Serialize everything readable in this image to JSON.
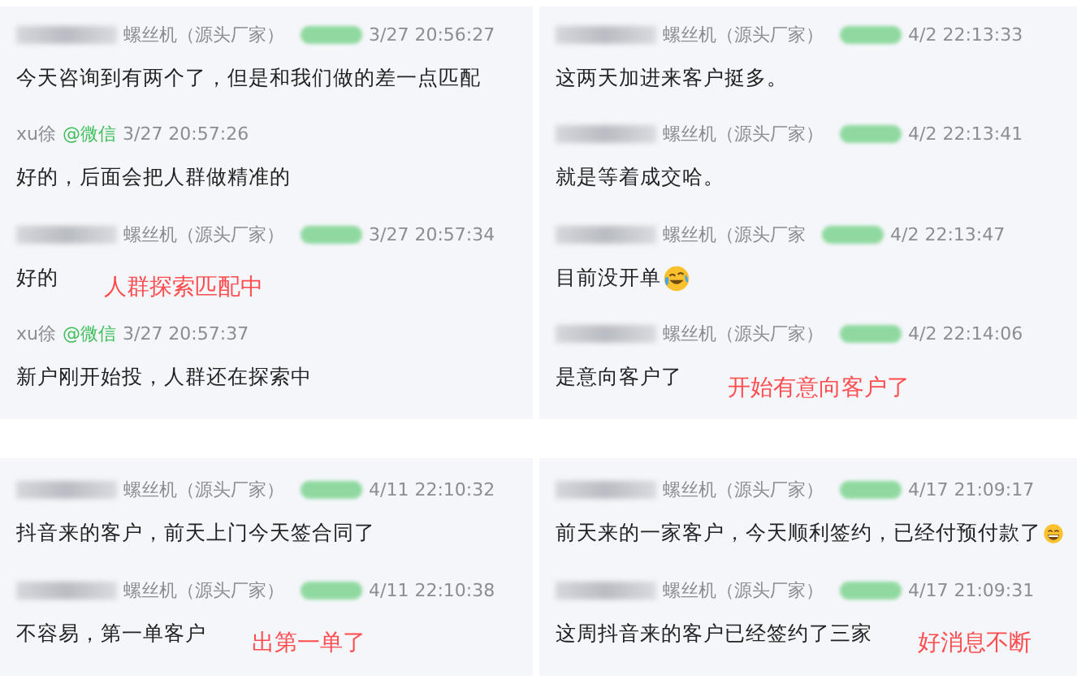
{
  "panels": [
    {
      "messages": [
        {
          "kind": "customer",
          "name": "螺丝机（源头厂家）",
          "time": "3/27 20:56:27",
          "text": "今天咨询到有两个了，但是和我们做的差一点匹配"
        },
        {
          "kind": "agent",
          "name": "xu徐",
          "channel": "@微信",
          "time": "3/27 20:57:26",
          "text": "好的，后面会把人群做精准的"
        },
        {
          "kind": "customer",
          "name": "螺丝机（源头厂家）",
          "time": "3/27 20:57:34",
          "text": "好的",
          "note": "人群探索匹配中"
        },
        {
          "kind": "agent",
          "name": "xu徐",
          "channel": "@微信",
          "time": "3/27 20:57:37",
          "text": "新户刚开始投，人群还在探索中"
        }
      ]
    },
    {
      "messages": [
        {
          "kind": "customer",
          "name": "螺丝机（源头厂家）",
          "time": "4/2 22:13:33",
          "text": "这两天加进来客户挺多。"
        },
        {
          "kind": "customer",
          "name": "螺丝机（源头厂家）",
          "time": "4/2 22:13:41",
          "text": "就是等着成交哈。"
        },
        {
          "kind": "customer",
          "name": "螺丝机（源头厂家",
          "time": "4/2 22:13:47",
          "text": "目前没开单",
          "emoji": {
            "kind": "tears"
          }
        },
        {
          "kind": "customer",
          "name": "螺丝机（源头厂家）",
          "time": "4/2 22:14:06",
          "text": "是意向客户了",
          "note": "开始有意向客户了"
        }
      ]
    },
    {
      "messages": [
        {
          "kind": "customer",
          "name": "螺丝机（源头厂家）",
          "time": "4/11 22:10:32",
          "text": "抖音来的客户，前天上门今天签合同了"
        },
        {
          "kind": "customer",
          "name": "螺丝机（源头厂家）",
          "time": "4/11 22:10:38",
          "text": "不容易，第一单客户",
          "note": "出第一单了"
        }
      ]
    },
    {
      "messages": [
        {
          "kind": "customer",
          "name": "螺丝机（源头厂家）",
          "time": "4/17 21:09:17",
          "text": "前天来的一家客户，今天顺利签约，已经付预付款了",
          "emoji": {
            "kind": "grin"
          }
        },
        {
          "kind": "customer",
          "name": "螺丝机（源头厂家）",
          "time": "4/17 21:09:31",
          "text": "这周抖音来的客户已经签约了三家",
          "note": "好消息不断"
        }
      ]
    }
  ]
}
